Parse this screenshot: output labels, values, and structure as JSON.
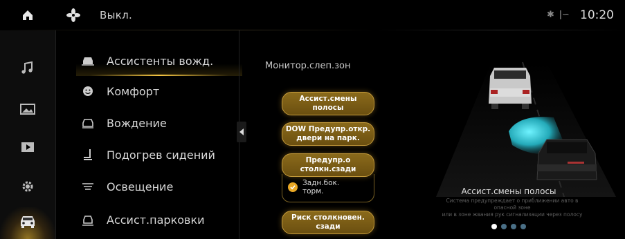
{
  "statusbar": {
    "fan_status": "Выкл.",
    "time": "10:20",
    "bluetooth_icon": "bluetooth-icon",
    "signal_icon": "signal-icon"
  },
  "rail": {
    "items": [
      {
        "icon": "home-icon"
      },
      {
        "icon": "music-icon"
      },
      {
        "icon": "gallery-icon"
      },
      {
        "icon": "video-icon"
      },
      {
        "icon": "settings-gear-icon"
      },
      {
        "icon": "car-icon",
        "active": true
      }
    ]
  },
  "menu": {
    "items": [
      {
        "label": "Ассистенты вожд.",
        "icon": "driver-assist-icon",
        "active": true
      },
      {
        "label": "Комфорт",
        "icon": "comfort-icon"
      },
      {
        "label": "Вождение",
        "icon": "driving-icon"
      },
      {
        "label": "Подогрев сидений",
        "icon": "seat-heat-icon"
      },
      {
        "label": "Освещение",
        "icon": "lighting-icon"
      },
      {
        "label": "Ассист.парковки",
        "icon": "parking-assist-icon"
      }
    ]
  },
  "panel": {
    "title": "Монитор.слеп.зон",
    "buttons": [
      {
        "line1": "Ассист.смены",
        "line2": "полосы"
      },
      {
        "line1": "DOW Предупр.откр.",
        "line2": "двери на парк."
      },
      {
        "line1": "Предупр.о",
        "line2": "столкн.сзади"
      },
      {
        "line1": "Риск столкновен.",
        "line2": "сзади"
      }
    ],
    "checkbox": {
      "line1": "Задн.бок.",
      "line2": "торм.",
      "checked": true
    }
  },
  "illustration": {
    "caption_title": "Ассист.смены полосы",
    "caption_line1": "Система предупреждает о приближении авто в",
    "caption_line2": "опасной зоне",
    "caption_line3": "или в зоне жвания рук сигнализации через полосу",
    "dots_total": 4,
    "dots_active": 0
  },
  "colors": {
    "accent": "#f5c542",
    "pill_bg": "#7a5c16",
    "blind_spot": "#3fd6e0"
  }
}
